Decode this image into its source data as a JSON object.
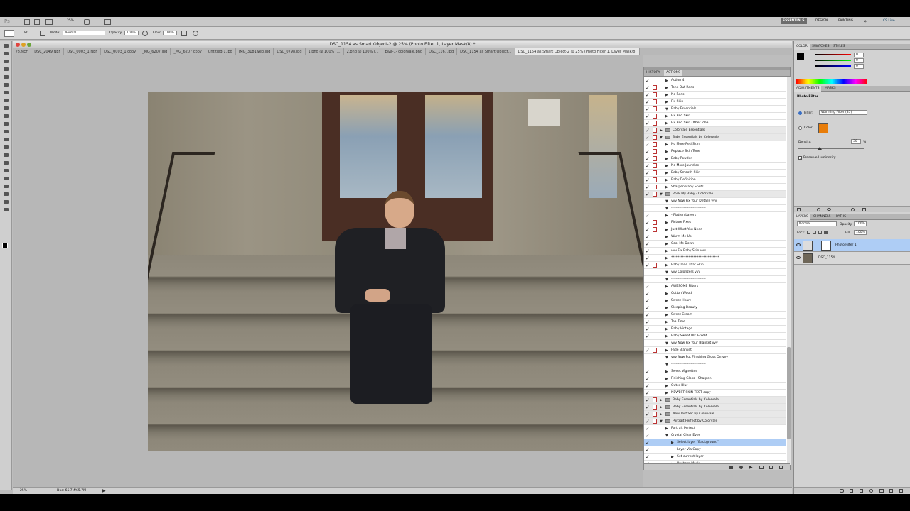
{
  "workspace": {
    "essentials": "ESSENTIALS",
    "design": "DESIGN",
    "painting": "PAINTING",
    "more": "»",
    "cslive": "CS Live"
  },
  "topbar": {
    "logo": "Ps",
    "zoom": "25%"
  },
  "options": {
    "mode_label": "Mode:",
    "mode_value": "Normal",
    "opacity_label": "Opacity:",
    "opacity_value": "100%",
    "flow_label": "Flow:",
    "flow_value": "100%",
    "brush_size": "80"
  },
  "document": {
    "title": "DSC_1154 as Smart Object-2 @ 25% (Photo Filter 1, Layer Mask/8) *"
  },
  "tabs": [
    {
      "label": "?8.NEF"
    },
    {
      "label": "DSC_2049.NEF"
    },
    {
      "label": "DSC_0003_1.NEF"
    },
    {
      "label": "DSC_0003_1 copy"
    },
    {
      "label": "_MG_6207.jpg"
    },
    {
      "label": "_MG_6207 copy"
    },
    {
      "label": "Untitled-1.jpg"
    },
    {
      "label": "IMG_3181web.jpg"
    },
    {
      "label": "DSC_0798.jpg"
    },
    {
      "label": "1.png @ 100% (..."
    },
    {
      "label": "2.png @ 100% (..."
    },
    {
      "label": "b&a-1- colorvale.png"
    },
    {
      "label": "DSC_1167.jpg"
    },
    {
      "label": "DSC_1154 as Smart Object..."
    },
    {
      "label": "DSC_1154 as Smart Object-2 @ 25% (Photo Filter 1, Layer Mask/8)"
    }
  ],
  "status": {
    "zoom": "25%",
    "doc": "Doc: 65.7M/65.7M"
  },
  "actions_panel": {
    "tab_history": "HISTORY",
    "tab_actions": "ACTIONS",
    "rows": [
      {
        "t": "Action 4",
        "lvl": 2,
        "type": "item",
        "dlg": false,
        "chk": true
      },
      {
        "t": "Tone Out Reds",
        "lvl": 2,
        "type": "item",
        "dlg": true,
        "chk": true
      },
      {
        "t": "No Reds",
        "lvl": 2,
        "type": "item",
        "dlg": true,
        "chk": true
      },
      {
        "t": "Fix Skin",
        "lvl": 2,
        "type": "item",
        "dlg": true,
        "chk": true
      },
      {
        "t": "Baby Essentials",
        "lvl": 2,
        "type": "open",
        "dlg": true,
        "chk": true
      },
      {
        "t": "Fix Red Skin",
        "lvl": 2,
        "type": "item",
        "dlg": true,
        "chk": true
      },
      {
        "t": "Fix Red Skin Other Idea",
        "lvl": 2,
        "type": "item",
        "dlg": true,
        "chk": true
      },
      {
        "t": "Colorvale Essentials",
        "lvl": 1,
        "type": "folder",
        "dlg": true,
        "chk": true
      },
      {
        "t": "Baby Essentials by Colorvale",
        "lvl": 1,
        "type": "folderopen",
        "dlg": true,
        "chk": true
      },
      {
        "t": "No More Red Skin",
        "lvl": 2,
        "type": "item",
        "dlg": true,
        "chk": true
      },
      {
        "t": "Replace Skin Tone",
        "lvl": 2,
        "type": "item",
        "dlg": true,
        "chk": true
      },
      {
        "t": "Baby Powder",
        "lvl": 2,
        "type": "item",
        "dlg": true,
        "chk": true
      },
      {
        "t": "No More Jaundice",
        "lvl": 2,
        "type": "item",
        "dlg": true,
        "chk": true
      },
      {
        "t": "Baby Smooth Skin",
        "lvl": 2,
        "type": "item",
        "dlg": true,
        "chk": true
      },
      {
        "t": "Baby Definition",
        "lvl": 2,
        "type": "item",
        "dlg": true,
        "chk": true
      },
      {
        "t": "Sharpen Baby Spots",
        "lvl": 2,
        "type": "item",
        "dlg": true,
        "chk": true
      },
      {
        "t": "Rock My Baby - Colorvale",
        "lvl": 1,
        "type": "folderopen",
        "dlg": true,
        "chk": true
      },
      {
        "t": "vvv Now Fix Your Details vvv",
        "lvl": 2,
        "type": "open",
        "dlg": false,
        "chk": false
      },
      {
        "t": "------------------------------",
        "lvl": 2,
        "type": "open",
        "dlg": false,
        "chk": false
      },
      {
        "t": "- Flatten Layers",
        "lvl": 2,
        "type": "item",
        "dlg": false,
        "chk": true
      },
      {
        "t": "Picture Fixes",
        "lvl": 2,
        "type": "item",
        "dlg": true,
        "chk": true
      },
      {
        "t": "Just What You Need",
        "lvl": 2,
        "type": "item",
        "dlg": true,
        "chk": true
      },
      {
        "t": "Warm Me Up",
        "lvl": 2,
        "type": "item",
        "dlg": false,
        "chk": true
      },
      {
        "t": "Cool Me Down",
        "lvl": 2,
        "type": "item",
        "dlg": false,
        "chk": true
      },
      {
        "t": "vvv Fix Baby Skin vvv",
        "lvl": 2,
        "type": "item",
        "dlg": false,
        "chk": true
      },
      {
        "t": "******************************",
        "lvl": 2,
        "type": "item",
        "dlg": false,
        "chk": true
      },
      {
        "t": "Baby Tone That Skin",
        "lvl": 2,
        "type": "item",
        "dlg": true,
        "chk": true
      },
      {
        "t": "vvv Colorizers vvv",
        "lvl": 2,
        "type": "open",
        "dlg": false,
        "chk": false
      },
      {
        "t": "------------------------------",
        "lvl": 2,
        "type": "open",
        "dlg": false,
        "chk": false
      },
      {
        "t": "AWESOME Filters",
        "lvl": 2,
        "type": "item",
        "dlg": false,
        "chk": true
      },
      {
        "t": "Cotton Wood",
        "lvl": 2,
        "type": "item",
        "dlg": false,
        "chk": true
      },
      {
        "t": "Sweet Heart",
        "lvl": 2,
        "type": "item",
        "dlg": false,
        "chk": true
      },
      {
        "t": "Sleeping Beauty",
        "lvl": 2,
        "type": "item",
        "dlg": false,
        "chk": true
      },
      {
        "t": "Sweet Cream",
        "lvl": 2,
        "type": "item",
        "dlg": false,
        "chk": true
      },
      {
        "t": "Tea Time",
        "lvl": 2,
        "type": "item",
        "dlg": false,
        "chk": true
      },
      {
        "t": "Baby Vintage",
        "lvl": 2,
        "type": "item",
        "dlg": false,
        "chk": true
      },
      {
        "t": "Baby Sweet Blk & Wht",
        "lvl": 2,
        "type": "item",
        "dlg": false,
        "chk": true
      },
      {
        "t": "vvv Now Fix Your Blanket vvv",
        "lvl": 2,
        "type": "open",
        "dlg": false,
        "chk": false
      },
      {
        "t": "Fade Blanket",
        "lvl": 2,
        "type": "item",
        "dlg": true,
        "chk": true
      },
      {
        "t": "vvv Now Put Finishing Gloss On vvv",
        "lvl": 2,
        "type": "open",
        "dlg": false,
        "chk": false
      },
      {
        "t": "------------------------------",
        "lvl": 2,
        "type": "open",
        "dlg": false,
        "chk": false
      },
      {
        "t": "Sweet Vignettes",
        "lvl": 2,
        "type": "item",
        "dlg": false,
        "chk": true
      },
      {
        "t": "Finishing Gloss - Sharpen",
        "lvl": 2,
        "type": "item",
        "dlg": false,
        "chk": true
      },
      {
        "t": "Outer Blur",
        "lvl": 2,
        "type": "item",
        "dlg": false,
        "chk": true
      },
      {
        "t": "NEWEST SKIN TEST copy",
        "lvl": 2,
        "type": "item",
        "dlg": false,
        "chk": true
      },
      {
        "t": "Baby Essentials by Colorvale",
        "lvl": 1,
        "type": "folder",
        "dlg": true,
        "chk": true
      },
      {
        "t": "Baby Essentials by Colorvale",
        "lvl": 1,
        "type": "folder",
        "dlg": true,
        "chk": true
      },
      {
        "t": "New Test Set by Colorvale",
        "lvl": 1,
        "type": "folder",
        "dlg": true,
        "chk": true
      },
      {
        "t": "Portrait Perfect by Colorvale",
        "lvl": 1,
        "type": "folderopen",
        "dlg": true,
        "chk": true
      },
      {
        "t": "Portrait Perfect",
        "lvl": 2,
        "type": "item",
        "dlg": false,
        "chk": true
      },
      {
        "t": "Crystal Clear Eyes",
        "lvl": 2,
        "type": "open",
        "dlg": false,
        "chk": true
      },
      {
        "t": "Select layer \"Background\"",
        "lvl": 3,
        "type": "item",
        "dlg": false,
        "chk": true,
        "sel": true
      },
      {
        "t": "Layer Via Copy",
        "lvl": 3,
        "type": "none",
        "dlg": false,
        "chk": true
      },
      {
        "t": "Set current layer",
        "lvl": 3,
        "type": "item",
        "dlg": false,
        "chk": true
      },
      {
        "t": "Unsharp Mask",
        "lvl": 3,
        "type": "item",
        "dlg": false,
        "chk": true
      }
    ]
  },
  "color_panel": {
    "tabs": [
      "COLOR",
      "SWATCHES",
      "STYLES"
    ],
    "r": "0",
    "g": "0",
    "b": "0"
  },
  "adjustments": {
    "tabs": [
      "ADJUSTMENTS",
      "MASKS"
    ],
    "title": "Photo Filter",
    "filter_label": "Filter:",
    "filter_value": "Warming Filter (85)",
    "color_label": "Color:",
    "density_label": "Density:",
    "density_value": "30",
    "density_unit": "%",
    "preserve": "Preserve Luminosity",
    "swatch": "#e87d0a"
  },
  "layers": {
    "tabs": [
      "LAYERS",
      "CHANNELS",
      "PATHS"
    ],
    "blend": "Normal",
    "opacity_label": "Opacity:",
    "opacity_value": "100%",
    "lock_label": "Lock:",
    "fill_label": "Fill:",
    "fill_value": "100%",
    "items": [
      {
        "name": "Photo Filter 1"
      },
      {
        "name": "DSC_1154"
      }
    ]
  }
}
